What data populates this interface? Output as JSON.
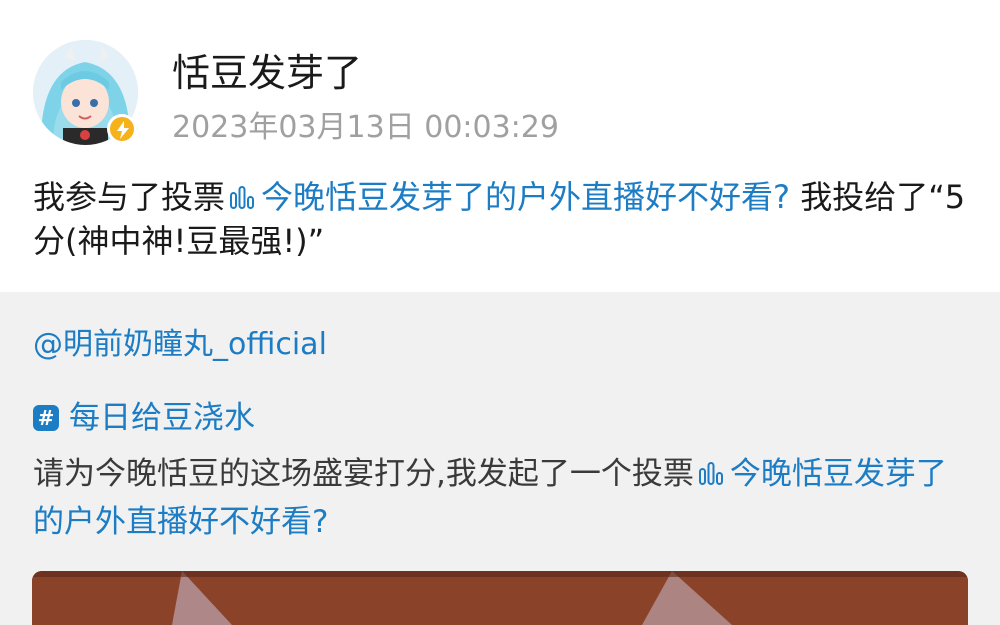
{
  "post": {
    "username": "恬豆发芽了",
    "timestamp": "2023年03月13日 00:03:29",
    "text_prefix": "我参与了投票",
    "vote_link": "今晚恬豆发芽了的户外直播好不好看?",
    "text_suffix": " 我投给了“5分(神中神!豆最强!)”"
  },
  "repost": {
    "mention": "@明前奶瞳丸_official",
    "topic": "每日给豆浇水",
    "text_prefix": "请为今晚恬豆的这场盛宴打分,我发起了一个投票",
    "vote_link": "今晚恬豆发芽了的户外直播好不好看?"
  },
  "icons": {
    "verified_badge": "lightning-badge-icon",
    "vote": "vote-bars-icon",
    "topic": "hashtag-icon"
  },
  "colors": {
    "link": "#1c7cc4",
    "badge": "#f6b21b",
    "repost_bg": "#f1f1f1"
  }
}
